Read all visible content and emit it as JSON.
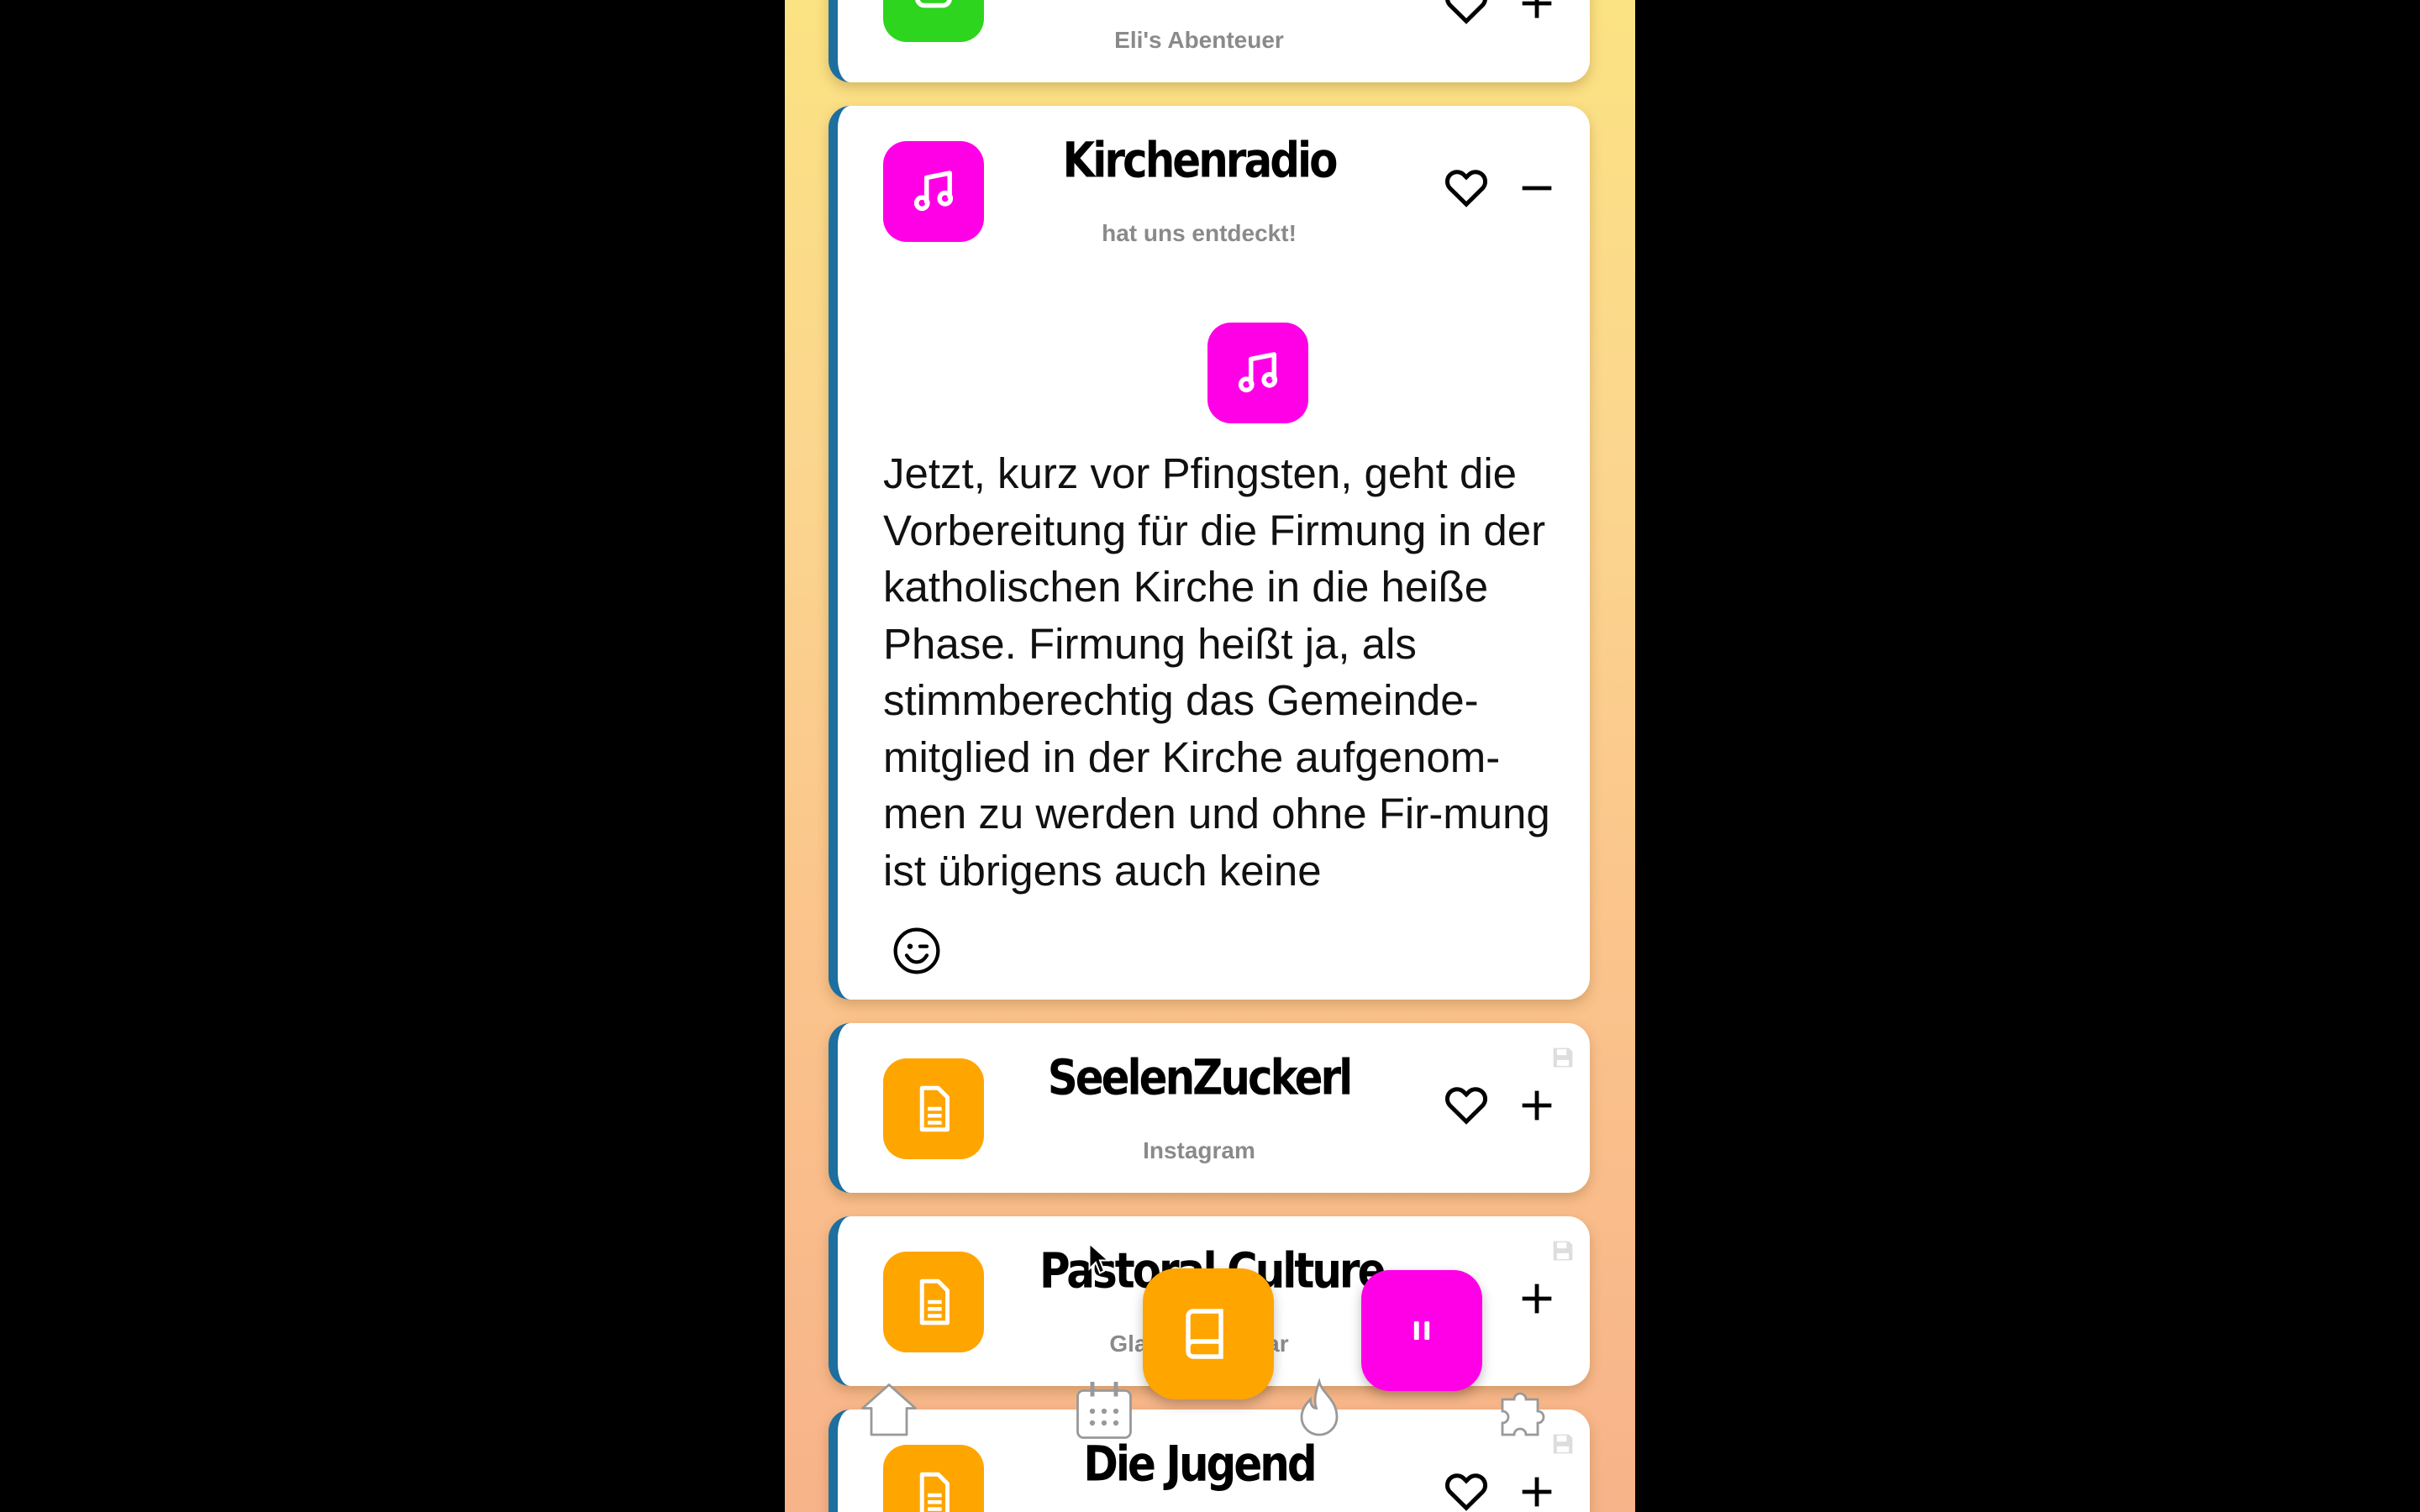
{
  "cards": {
    "elis": {
      "subtitle": "Eli's Abenteuer",
      "icon": "robot-icon",
      "color": "#2ed51f"
    },
    "kirchenradio": {
      "title": "Kirchenradio",
      "subtitle": "hat uns entdeckt!",
      "icon": "music-note-icon",
      "color": "#ff00e6",
      "body": "Jetzt, kurz vor Pfingsten, geht die Vorbereitung für die Firmung in der katholischen Kirche in die heiße Phase. Firmung heißt ja, als stimmberechtig das Gemeinde-mitglied in der Kirche aufgenom-men zu werden und ohne Fir-mung ist übrigens auch keine",
      "emoji": "☺"
    },
    "seelenzuckerl": {
      "title": "SeelenZuckerl",
      "subtitle": "Instagram",
      "icon": "document-icon",
      "color": "#ffa500"
    },
    "pastoral": {
      "title": "Pastoral Culture",
      "subtitle": "Glaube erlebbar",
      "icon": "document-icon",
      "color": "#ffa500"
    },
    "jugend": {
      "title": "Die Jugend",
      "icon": "document-icon",
      "color": "#ffa500"
    }
  },
  "fabs": {
    "book": {
      "icon": "book-icon",
      "color": "#ffa500"
    },
    "pause": {
      "icon": "pause-icon",
      "color": "#ff00e6"
    }
  },
  "nav": [
    "home-icon",
    "calendar-icon",
    "flame-icon",
    "puzzle-icon"
  ],
  "colors": {
    "card_border": "#1d6f9f",
    "subtitle_gray": "#8a8a8a"
  }
}
